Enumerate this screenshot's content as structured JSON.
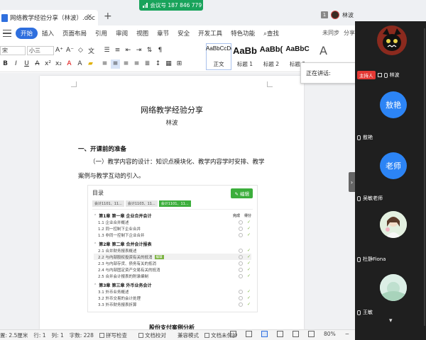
{
  "titlebar": {
    "tab_title": "网络教学经验分享（林波）.doc",
    "meeting_label": "会议号 187 846 779",
    "count_badge": "1",
    "user_name": "林波"
  },
  "menu": {
    "items": [
      "开始",
      "插入",
      "页面布局",
      "引用",
      "审阅",
      "视图",
      "章节",
      "安全",
      "开发工具",
      "特色功能"
    ],
    "search": "查找",
    "sync": "未同步",
    "share": "分享"
  },
  "ribbon": {
    "font_name": "宋",
    "font_size": "小三",
    "styles": [
      {
        "sample": "AaBbCcDd",
        "name": "正文"
      },
      {
        "sample": "AaBb",
        "name": "标题 1"
      },
      {
        "sample": "AaBb(",
        "name": "标题 2"
      },
      {
        "sample": "AaBbC",
        "name": "标题 3"
      }
    ],
    "new_style": "新样式"
  },
  "document": {
    "title": "网络教学经验分享",
    "author": "林波",
    "heading1": "一、开课前的准备",
    "paragraph": "（一）教学内容的设计：知识点模块化、教学内容学时安排、教学案例与教学互动的引入。",
    "heading2": "股份支付案例分析"
  },
  "embedded": {
    "title": "目录",
    "edit_label": "编辑",
    "tabs": [
      "会计1101、11...",
      "会计1103、11...",
      "会计1101、11..."
    ],
    "col1": "完成",
    "col2": "得分",
    "rows": [
      {
        "text": "第1章 第一章 企业合并会计",
        "type": "chapter"
      },
      {
        "text": "1.1 企业合并概述",
        "type": "item"
      },
      {
        "text": "1.2 同一控制下企业合并",
        "type": "item"
      },
      {
        "text": "1.3 非同一控制下企业合并",
        "type": "item"
      },
      {
        "text": "第2章 第二章 合并会计报表",
        "type": "chapter"
      },
      {
        "text": "2.1 合并财务报表概述",
        "type": "item"
      },
      {
        "text": "2.2 与内部股权投资有关的抵消",
        "type": "item",
        "tag": "编辑"
      },
      {
        "text": "2.3 与内部存货、债务有关的抵消",
        "type": "item"
      },
      {
        "text": "2.4 与内部固定资产交易有关的抵消",
        "type": "item"
      },
      {
        "text": "2.5 合并会计报表的附录编制",
        "type": "item"
      },
      {
        "text": "第3章 第三章 外币业务会计",
        "type": "chapter"
      },
      {
        "text": "3.1 外币业务概述",
        "type": "item"
      },
      {
        "text": "3.2 外币交易的会计处理",
        "type": "item"
      },
      {
        "text": "3.3 外币财务报表折算",
        "type": "item"
      }
    ]
  },
  "statusbar": {
    "position": "置: 2.5厘米",
    "row": "行: 1",
    "col": "列: 1",
    "word_count": "字数: 228",
    "spell": "拼写检查",
    "proof": "文档校对",
    "mode": "兼容模式",
    "protect": "文档未保护",
    "zoom": "80%"
  },
  "speaking": {
    "label": "正在讲话:"
  },
  "participants": [
    {
      "name": "林波",
      "host_label": "主持人",
      "avatar": "cat-avatar"
    },
    {
      "name": "敖艳",
      "initials": "敖艳",
      "color": "#2c84f5"
    },
    {
      "name": "吴敏老师",
      "initials": "老师",
      "color": "#2c84f5"
    },
    {
      "name": "杜静Fiona",
      "avatar": "photo-avatar"
    },
    {
      "name": "王敏",
      "avatar": "photo-avatar"
    }
  ]
}
